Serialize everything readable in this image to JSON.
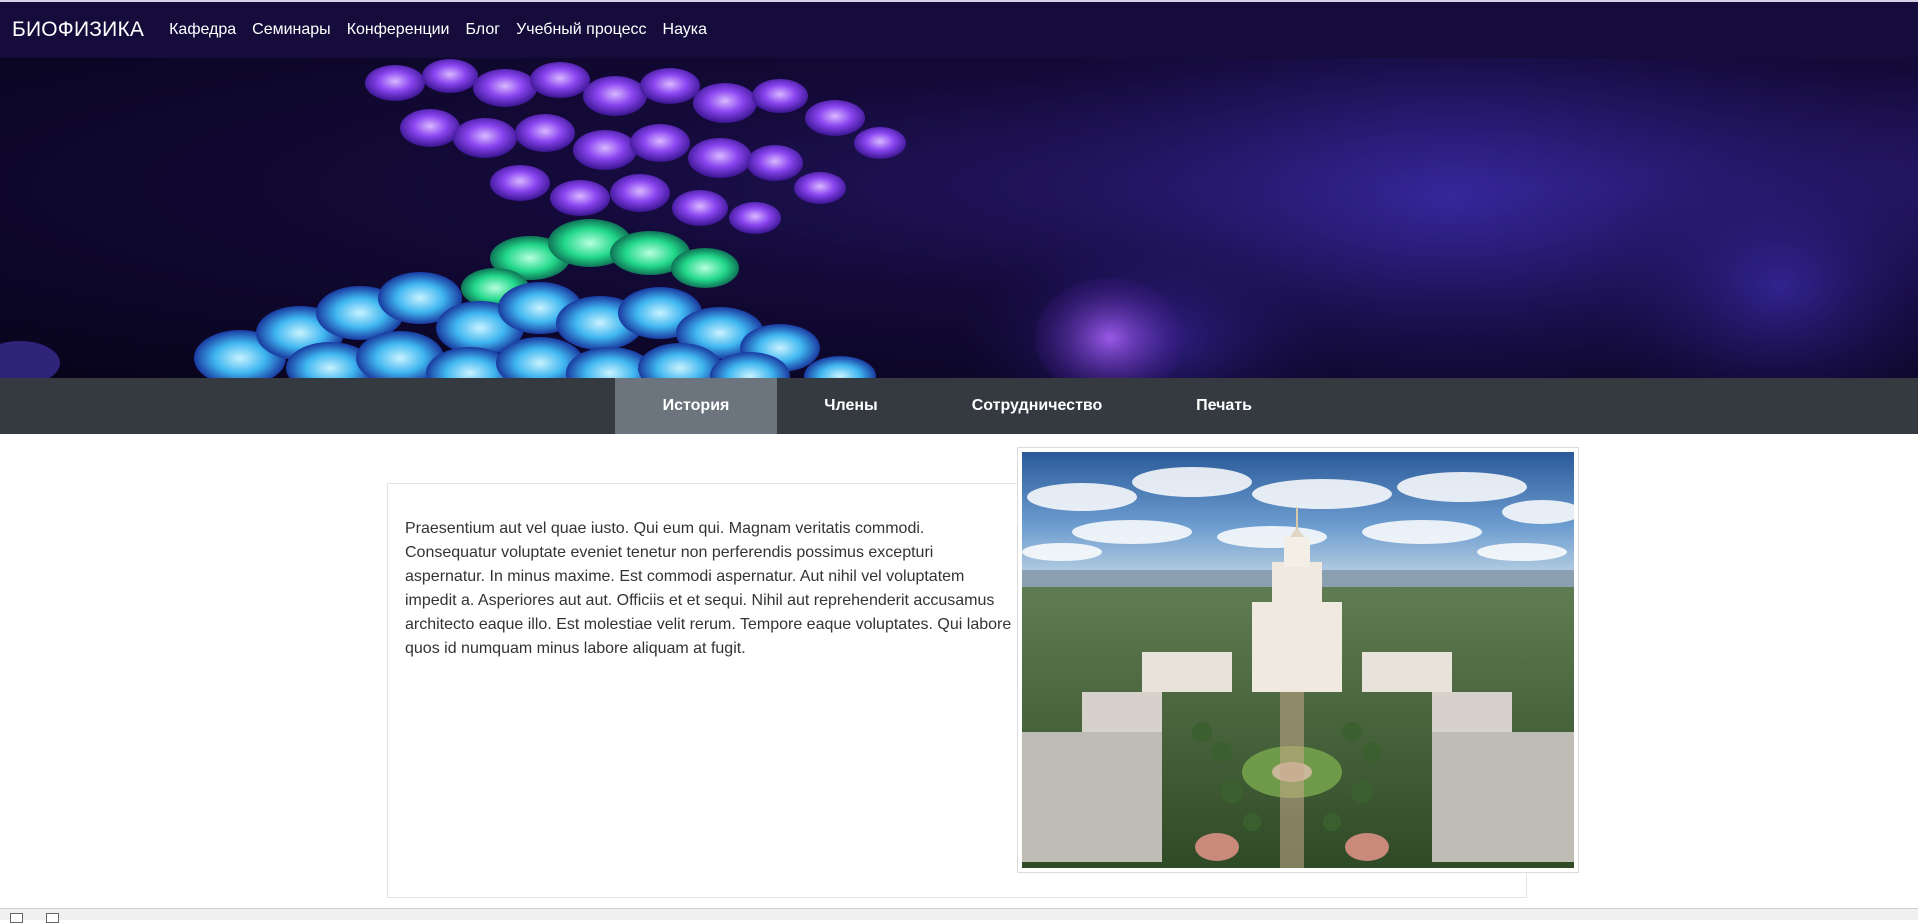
{
  "navbar": {
    "brand": "БИОФИЗИКА",
    "links": [
      "Кафедра",
      "Семинары",
      "Конференции",
      "Блог",
      "Учебный процесс",
      "Наука"
    ]
  },
  "hero": {
    "icon": "coral-banner-image"
  },
  "tabs": {
    "items": [
      "История",
      "Члены",
      "Сотрудничество",
      "Печать"
    ],
    "active": "История"
  },
  "content": {
    "paragraph": "Praesentium aut vel quae iusto. Qui eum qui. Magnam veritatis commodi. Consequatur voluptate eveniet tenetur non perferendis possimus excepturi aspernatur. In minus maxime. Est commodi aspernatur. Aut nihil vel voluptatem impedit a. Asperiores aut aut. Officiis et et sequi. Nihil aut reprehenderit accusamus architecto eaque illo. Est molestiae velit rerum. Tempore eaque voluptates. Qui labore quos id numquam minus labore aliquam at fugit."
  },
  "photo": {
    "icon": "university-building-photo"
  },
  "colors": {
    "navbar_bg": "#150c3c",
    "tabbar_bg": "#343a40",
    "tab_active_bg": "#6c757d"
  }
}
